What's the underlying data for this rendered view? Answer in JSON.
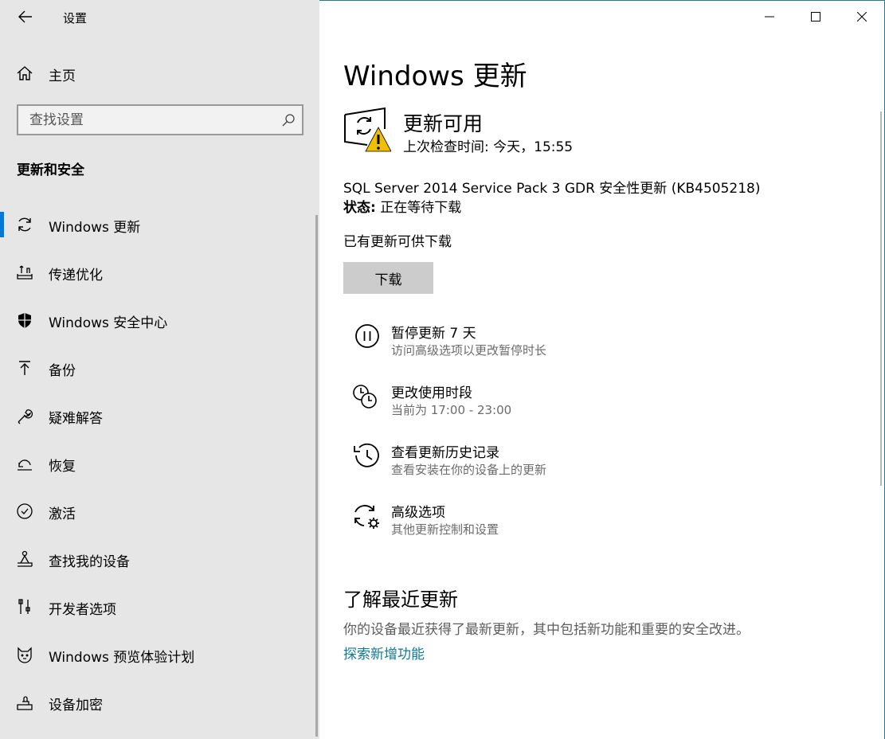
{
  "window": {
    "app_title": "设置",
    "accent_color": "#0078d7",
    "link_color": "#0f7a95",
    "controls": {
      "minimize_icon": "minimize-icon",
      "maximize_icon": "maximize-icon",
      "close_icon": "close-icon"
    }
  },
  "sidebar": {
    "back_icon": "back-arrow-icon",
    "home_label": "主页",
    "search_placeholder": "查找设置",
    "section_title": "更新和安全",
    "items": [
      {
        "label": "Windows 更新",
        "icon": "sync-icon",
        "active": true
      },
      {
        "label": "传递优化",
        "icon": "delivery-optimization-icon"
      },
      {
        "label": "Windows 安全中心",
        "icon": "shield-icon"
      },
      {
        "label": "备份",
        "icon": "backup-arrow-icon"
      },
      {
        "label": "疑难解答",
        "icon": "wrench-icon"
      },
      {
        "label": "恢复",
        "icon": "recovery-icon"
      },
      {
        "label": "激活",
        "icon": "check-circle-icon"
      },
      {
        "label": "查找我的设备",
        "icon": "find-device-icon"
      },
      {
        "label": "开发者选项",
        "icon": "developer-tools-icon"
      },
      {
        "label": "Windows 预览体验计划",
        "icon": "insider-cat-icon"
      },
      {
        "label": "设备加密",
        "icon": "device-encryption-icon"
      }
    ]
  },
  "main": {
    "title": "Windows 更新",
    "status": {
      "icon": "update-warning-icon",
      "heading": "更新可用",
      "last_checked": "上次检查时间: 今天，15:55"
    },
    "update": {
      "name": "SQL Server 2014 Service Pack 3 GDR 安全性更新 (KB4505218)",
      "state_label": "状态:",
      "state_value": "正在等待下载"
    },
    "available_text": "已有更新可供下载",
    "download_button": "下载",
    "options": [
      {
        "title": "暂停更新 7 天",
        "subtitle": "访问高级选项以更改暂停时长",
        "icon": "pause-icon"
      },
      {
        "title": "更改使用时段",
        "subtitle": "当前为 17:00 - 23:00",
        "icon": "active-hours-clock-icon"
      },
      {
        "title": "查看更新历史记录",
        "subtitle": "查看安装在你的设备上的更新",
        "icon": "history-icon"
      },
      {
        "title": "高级选项",
        "subtitle": "其他更新控制和设置",
        "icon": "advanced-options-gear-icon"
      }
    ],
    "learn": {
      "title": "了解最近更新",
      "description": "你的设备最近获得了最新更新，其中包括新功能和重要的安全改进。",
      "link": "探索新增功能"
    }
  }
}
